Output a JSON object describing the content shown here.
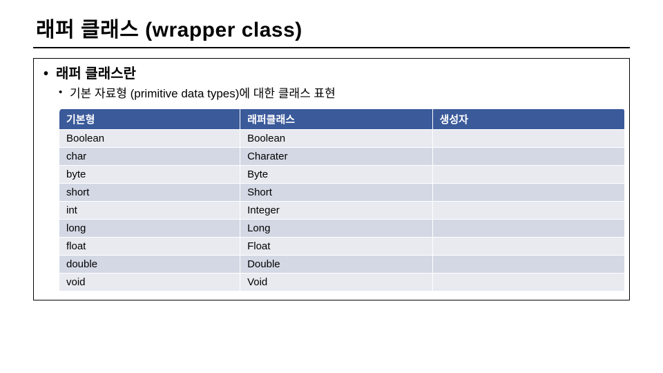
{
  "title": "래퍼 클래스 (wrapper class)",
  "bullets": {
    "l1": "래퍼 클래스란",
    "l2": "기본 자료형 (primitive data types)에 대한 클래스 표현"
  },
  "table": {
    "headers": [
      "기본형",
      "래퍼클래스",
      "생성자"
    ],
    "rows": [
      {
        "c0": "Boolean",
        "c1": "Boolean",
        "c2": ""
      },
      {
        "c0": "char",
        "c1": "Charater",
        "c2": ""
      },
      {
        "c0": "byte",
        "c1": "Byte",
        "c2": ""
      },
      {
        "c0": "short",
        "c1": "Short",
        "c2": ""
      },
      {
        "c0": "int",
        "c1": "Integer",
        "c2": ""
      },
      {
        "c0": "long",
        "c1": "Long",
        "c2": ""
      },
      {
        "c0": "float",
        "c1": "Float",
        "c2": ""
      },
      {
        "c0": "double",
        "c1": "Double",
        "c2": ""
      },
      {
        "c0": "void",
        "c1": "Void",
        "c2": ""
      }
    ]
  },
  "chart_data": {
    "type": "table",
    "title": "래퍼 클래스 (wrapper class)",
    "columns": [
      "기본형",
      "래퍼클래스",
      "생성자"
    ],
    "rows": [
      [
        "Boolean",
        "Boolean",
        ""
      ],
      [
        "char",
        "Charater",
        ""
      ],
      [
        "byte",
        "Byte",
        ""
      ],
      [
        "short",
        "Short",
        ""
      ],
      [
        "int",
        "Integer",
        ""
      ],
      [
        "long",
        "Long",
        ""
      ],
      [
        "float",
        "Float",
        ""
      ],
      [
        "double",
        "Double",
        ""
      ],
      [
        "void",
        "Void",
        ""
      ]
    ]
  }
}
